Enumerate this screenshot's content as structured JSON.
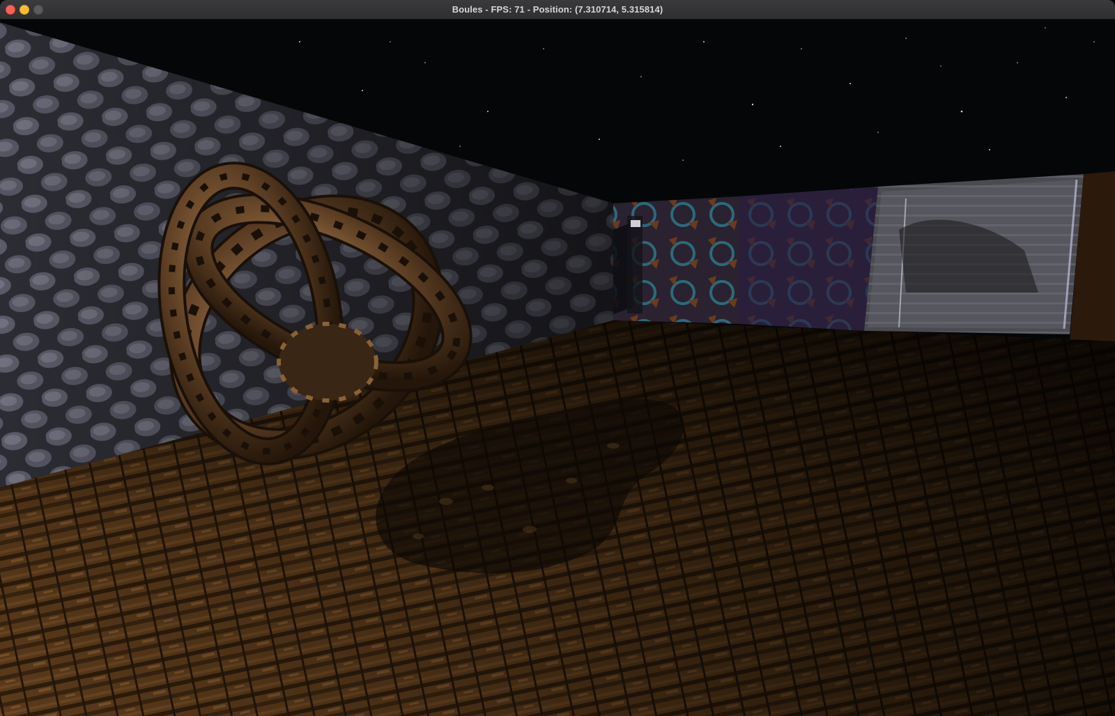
{
  "window": {
    "title": "Boules - FPS: 71 - Position: (7.310714, 5.315814)",
    "fps": 71,
    "position": [
      7.310714,
      5.315814
    ]
  },
  "traffic_lights": {
    "close_color": "#ff5f57",
    "minimize_color": "#febc2e",
    "zoom_color": "#5b5b5e"
  },
  "scene": {
    "sky": "starfield",
    "left_wall": "cobblestone",
    "floor": "wooden planks",
    "back_wall": [
      "stone block",
      "pattern tiles",
      "glass window"
    ],
    "sculpture": "bronze perforated interlocking rings"
  }
}
